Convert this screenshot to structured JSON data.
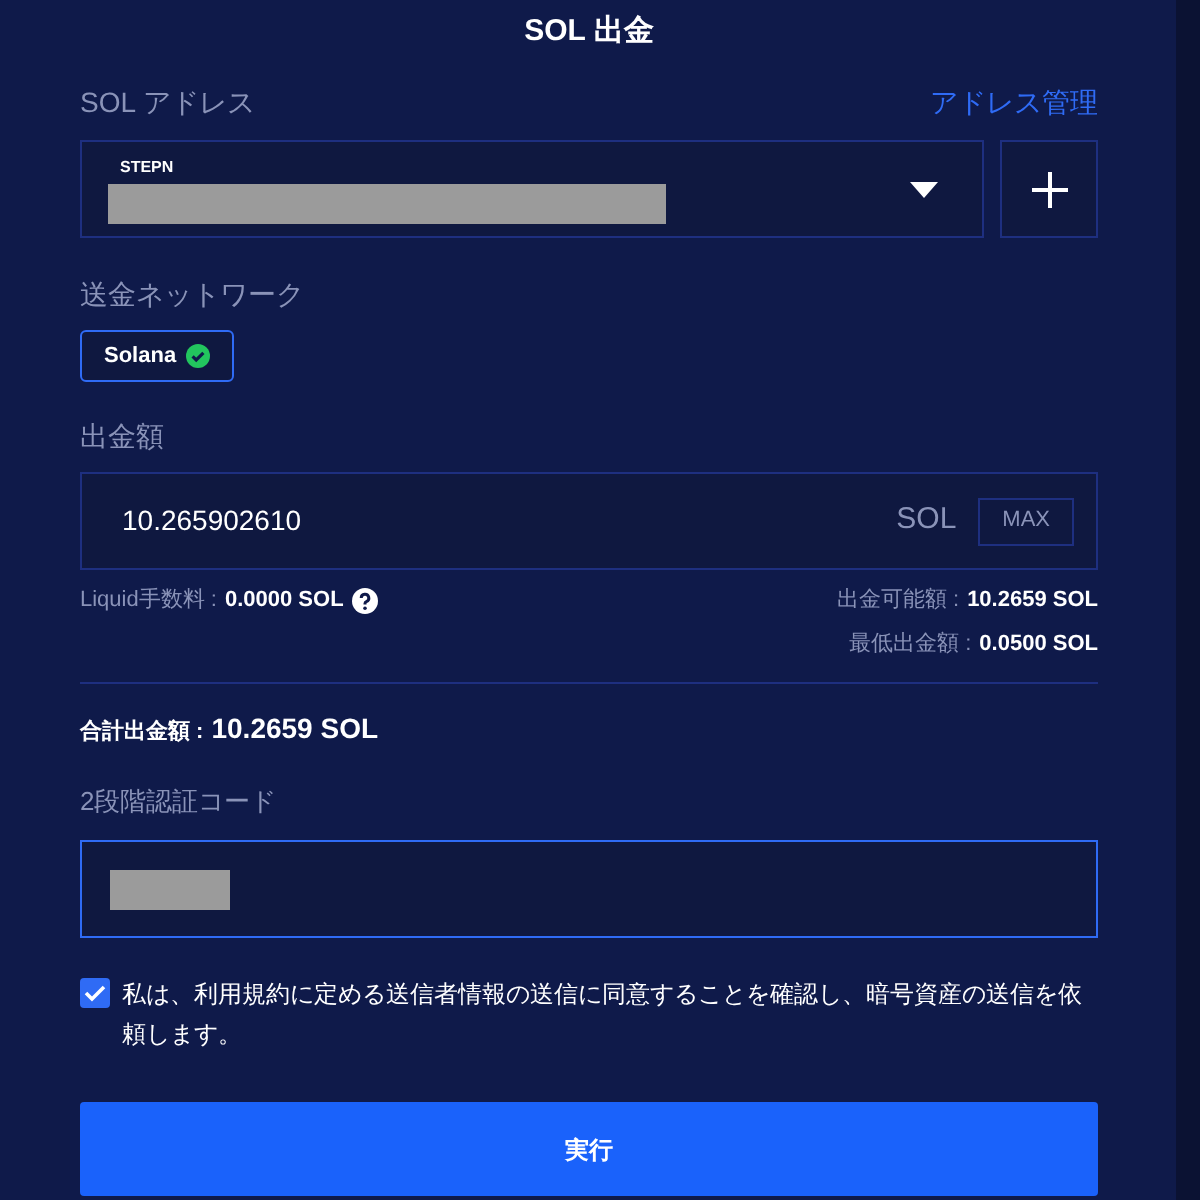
{
  "title": "SOL 出金",
  "address": {
    "label": "SOL アドレス",
    "manage_link": "アドレス管理",
    "selected_name": "STEPN",
    "redacted": true
  },
  "network": {
    "label": "送金ネットワーク",
    "options": [
      {
        "label": "Solana",
        "selected": true
      }
    ]
  },
  "amount": {
    "label": "出金額",
    "value": "10.265902610",
    "unit": "SOL",
    "max_button": "MAX"
  },
  "fee": {
    "label": "Liquid手数料 :",
    "value": "0.0000 SOL"
  },
  "available": {
    "label": "出金可能額 :",
    "value": "10.2659 SOL"
  },
  "minimum": {
    "label": "最低出金額 :",
    "value": "0.0500 SOL"
  },
  "total": {
    "label": "合計出金額 :",
    "value": "10.2659 SOL"
  },
  "two_factor": {
    "label": "2段階認証コード",
    "redacted": true
  },
  "agreement": {
    "text": "私は、利用規約に定める送信者情報の送信に同意することを確認し、暗号資産の送信を依頼します。",
    "checked": true
  },
  "submit": "実行"
}
